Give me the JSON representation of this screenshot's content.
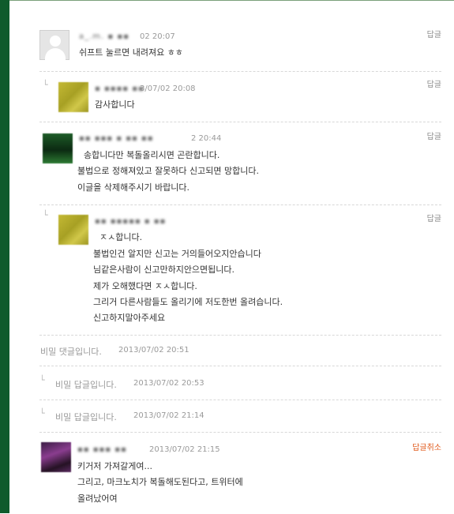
{
  "comments": [
    {
      "nickname": "a_.m. ▪ ▪▪",
      "date": "02 20:07",
      "lines": [
        "쉬프트 눌르면 내려져요 ㅎㅎ"
      ],
      "action": "답글"
    },
    {
      "nickname": "▪ ▪▪▪▪ ▪▪",
      "date": "3/07/02 20:08",
      "lines": [
        "감사합니다"
      ],
      "action": "답글"
    },
    {
      "nickname": "▪▪ ▪▪▪ ▪ ▪▪ ▪▪",
      "date": "2 20:44",
      "lines": [
        "송합니다만 복돌올리시면 곤란합니다.",
        "불법으로 정해져있고 잘못하다 신고되면 망합니다.",
        "이글을 삭제해주시기 바랍니다."
      ],
      "action": "답글"
    },
    {
      "nickname": "▪▪ ▪▪▪▪▪ ▪ ▪▪",
      "date": "",
      "lines": [
        "ㅈㅅ합니다.",
        "불법인건 알지만 신고는 거의들어오지안습니다",
        "님같은사람이 신고만하지안으면됩니다.",
        "제가 오해했다면 ㅈㅅ합니다.",
        "그리거 다른사람들도 올리기에 저도한번 올려습니다.",
        "신고하지말아주세요"
      ],
      "action": "답글"
    }
  ],
  "secret_comments": [
    {
      "text": "비밀 댓글입니다.",
      "date": "2013/07/02 20:51"
    },
    {
      "text": "비밀 답글입니다.",
      "date": "2013/07/02 20:53"
    },
    {
      "text": "비밀 답글입니다.",
      "date": "2013/07/02 21:14"
    }
  ],
  "last_comment": {
    "nickname": "▪▪ ▪▪▪ ▪▪",
    "date": "2013/07/02 21:15",
    "lines": [
      "키거저 가져갈게여...",
      "그리고, 마크노치가 복돌해도된다고, 트위터에",
      "올려났어여"
    ],
    "action": "답글취소"
  },
  "icons": {
    "reply_indent": "└",
    "avatar_default": "user-silhouette"
  },
  "colors": {
    "left_bar": "#0f5b2c",
    "cancel_action": "#e05a1c"
  }
}
